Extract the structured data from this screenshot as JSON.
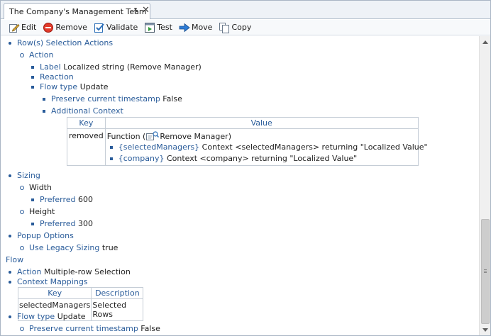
{
  "tab": {
    "title": "The Company's Management Team",
    "pin_glyph": "📌",
    "close_glyph": "✕"
  },
  "toolbar": {
    "edit": "Edit",
    "remove": "Remove",
    "validate": "Validate",
    "test": "Test",
    "move": "Move",
    "copy": "Copy"
  },
  "content": {
    "row_selection_actions": "Row(s) Selection Actions",
    "action": "Action",
    "label_key": "Label",
    "label_value": "Localized string (Remove Manager)",
    "reaction": "Reaction",
    "flow_type_key": "Flow type",
    "flow_type_value": "Update",
    "preserve_key": "Preserve current timestamp",
    "preserve_value": "False",
    "additional_context": "Additional Context",
    "context_table": {
      "col_key": "Key",
      "col_value": "Value",
      "row_key": "removed",
      "function_prefix": "Function (",
      "function_name": "Remove Manager)",
      "param1_ref": "{selectedManagers}",
      "param1_text": "Context <selectedManagers> returning \"Localized Value\"",
      "param2_ref": "{company}",
      "param2_text": "Context <company> returning \"Localized Value\""
    },
    "sizing": "Sizing",
    "width": "Width",
    "width_pref_key": "Preferred",
    "width_pref_value": "600",
    "height": "Height",
    "height_pref_key": "Preferred",
    "height_pref_value": "300",
    "popup_options": "Popup Options",
    "legacy_key": "Use Legacy Sizing",
    "legacy_value": "true",
    "flow": "Flow",
    "flow_action_key": "Action",
    "flow_action_value": "Multiple-row Selection",
    "context_mappings": "Context Mappings",
    "mapping_table": {
      "col_key": "Key",
      "col_desc": "Description",
      "row_key": "selectedManagers",
      "row_desc": "Selected Rows"
    },
    "flow2_type_key": "Flow type",
    "flow2_type_value": "Update",
    "flow2_preserve_key": "Preserve current timestamp",
    "flow2_preserve_value": "False"
  },
  "colors": {
    "accent": "#2a5c9a",
    "border": "#c5cdd6"
  }
}
